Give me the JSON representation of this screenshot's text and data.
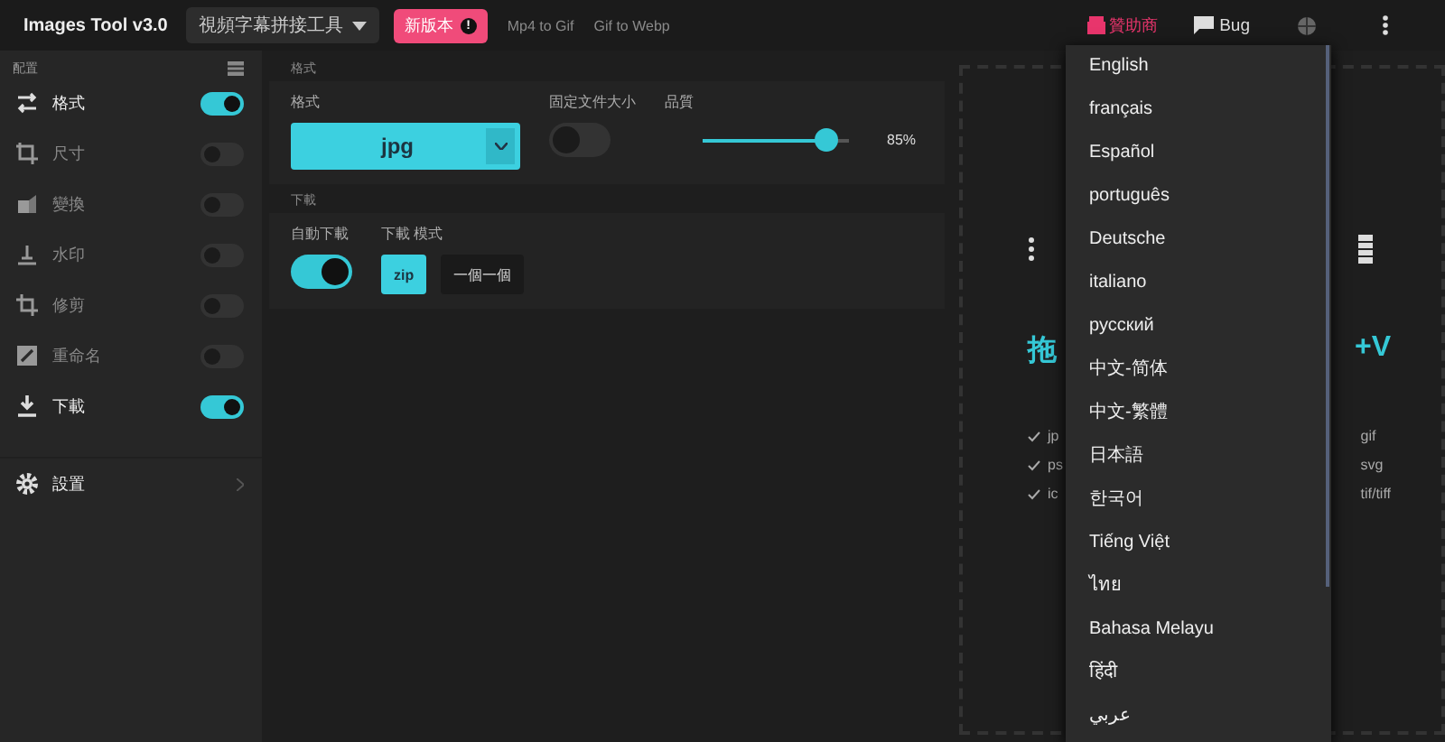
{
  "topbar": {
    "app_title": "Images Tool v3.0",
    "tool_select": "視頻字幕拼接工具",
    "new_version": {
      "label": "新版本",
      "badge": "!"
    },
    "links": [
      "Mp4 to Gif",
      "Gif to Webp"
    ],
    "sponsor": "贊助商",
    "bug": "Bug"
  },
  "sidebar": {
    "title": "配置",
    "items": [
      {
        "kind": "convert",
        "label": "格式",
        "on": true
      },
      {
        "kind": "resize",
        "label": "尺寸",
        "on": false
      },
      {
        "kind": "transform",
        "label": "變換",
        "on": false
      },
      {
        "kind": "watermark",
        "label": "水印",
        "on": false
      },
      {
        "kind": "crop",
        "label": "修剪",
        "on": false
      },
      {
        "kind": "rename",
        "label": "重命名",
        "on": false
      },
      {
        "kind": "download",
        "label": "下載",
        "on": true
      }
    ],
    "settings": "設置"
  },
  "format_section": {
    "title": "格式",
    "format_label": "格式",
    "format_value": "jpg",
    "fixed_size_label": "固定文件大小",
    "fixed_size_on": false,
    "quality_label": "品質",
    "quality": {
      "level": 0.85,
      "reading": "85%"
    }
  },
  "download_section": {
    "title": "下載",
    "auto_label": "自動下載",
    "auto_on": true,
    "mode_label": "下載 模式",
    "modes": [
      {
        "label": "zip",
        "selected": true
      },
      {
        "label": "一個一個",
        "selected": false
      }
    ]
  },
  "drop_zone": {
    "heading_left": "拖",
    "heading_right": "+V",
    "left_types": [
      "jp",
      "ps",
      "ic"
    ],
    "right_types": [
      "gif",
      "svg",
      "tif/tiff"
    ]
  },
  "language_menu": [
    "English",
    "français",
    "Español",
    "português",
    "Deutsche",
    "italiano",
    "русский",
    "中文-简体",
    "中文-繁體",
    "日本語",
    "한국어",
    "Tiếng Việt",
    "ไทย",
    "Bahasa Melayu",
    "हिंदी",
    "عربي"
  ]
}
